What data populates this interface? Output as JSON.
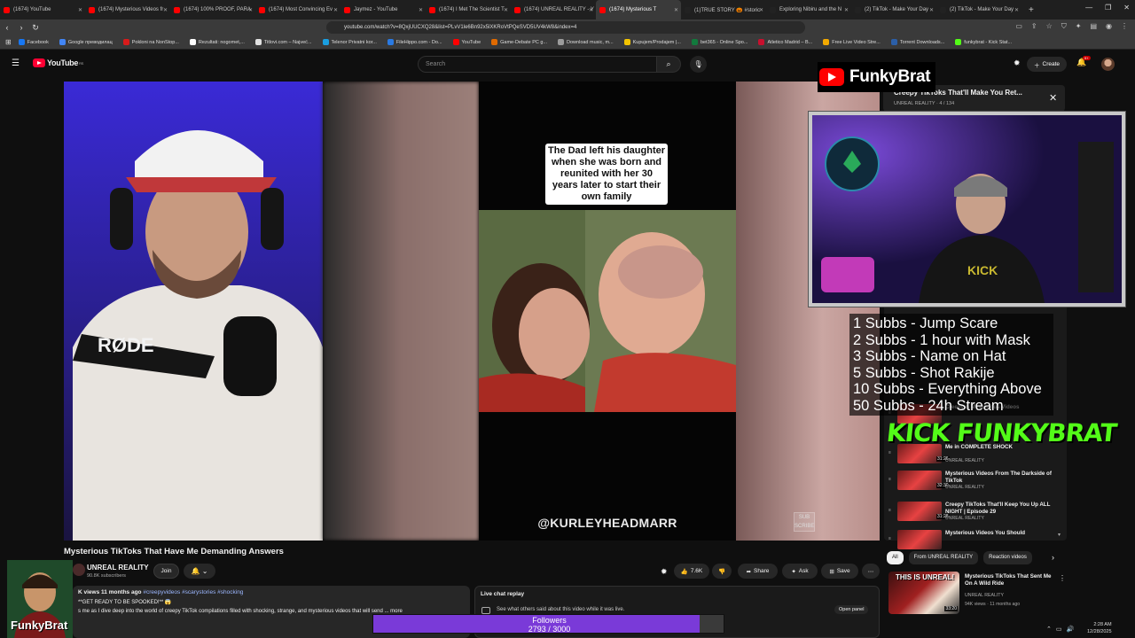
{
  "browser": {
    "tabs": [
      {
        "label": "(1674) YouTube",
        "color": "#ff0000"
      },
      {
        "label": "(1674) Mysterious Videos fr",
        "color": "#ff0000"
      },
      {
        "label": "(1674) 100% PROOF, PARA",
        "color": "#ff0000"
      },
      {
        "label": "(1674) Most Convincing Ev",
        "color": "#ff0000"
      },
      {
        "label": "Jaymez - YouTube",
        "color": "#ff0000"
      },
      {
        "label": "(1674) I Met The Scientist T",
        "color": "#ff0000"
      },
      {
        "label": "(1674) UNREAL REALITY - Y",
        "color": "#ff0000"
      },
      {
        "label": "(1674) Mysterious T",
        "color": "#ff0000",
        "active": true
      },
      {
        "label": "(1)TRUE STORY 🎃 #storic",
        "color": "#222222"
      },
      {
        "label": "Exploring Nibiru and the N",
        "color": "#222222"
      },
      {
        "label": "(2) TikTok - Make Your Day",
        "color": "#222222"
      },
      {
        "label": "(2) TikTok - Make Your Day",
        "color": "#222222"
      }
    ],
    "url": "youtube.com/watch?v=8QxjUUCXQ28&list=PLvV1le6Bn92x5lXKRoVtPQeSVD5UV4kW8&index=4",
    "bookmarks": [
      {
        "label": "Facebook",
        "color": "#1877f2"
      },
      {
        "label": "Google преводилац",
        "color": "#4285f4"
      },
      {
        "label": "Pokloni na NonStop...",
        "color": "#d81b1b"
      },
      {
        "label": "Rezultati: nogomet,...",
        "color": "#ffffff"
      },
      {
        "label": "Titlovi.com – Najveć...",
        "color": "#e0e0e0"
      },
      {
        "label": "Telenor Privatni kor...",
        "color": "#1a9ee0"
      },
      {
        "label": "FileHippo.com - Do...",
        "color": "#2a7ae2"
      },
      {
        "label": "YouTube",
        "color": "#ff0000"
      },
      {
        "label": "Game-Debate PC g...",
        "color": "#e06a00"
      },
      {
        "label": "Download music, m...",
        "color": "#9c9c9c"
      },
      {
        "label": "Kupujem/Prodajem |...",
        "color": "#f4c400"
      },
      {
        "label": "bet365 - Online Spo...",
        "color": "#127a3d"
      },
      {
        "label": "Atletico Madrid – B...",
        "color": "#c8102e"
      },
      {
        "label": "Free Live Video Stre...",
        "color": "#f2a900"
      },
      {
        "label": "Torrent Downloads...",
        "color": "#2b5fa8"
      },
      {
        "label": "funkybrat - Kick Stat...",
        "color": "#53fc18"
      }
    ]
  },
  "youtube": {
    "logo_text": "YouTube",
    "logo_region": "RS",
    "search_placeholder": "Search",
    "create_label": "Create",
    "notif_count": "9+",
    "video_title": "Mysterious TikToks That Have Me Demanding Answers",
    "channel_name": "UNREAL REALITY",
    "channel_subs": "90.8K subscribers",
    "join_label": "Join",
    "like_count": "7.6K",
    "share_label": "Share",
    "ask_label": "Ask",
    "save_label": "Save",
    "desc_meta": "K views  11 months ago",
    "desc_tags": "#creepyvideos #scarystories #shocking",
    "desc_line1": "**GET READY TO BE SPOOKED!** 😱",
    "desc_line2": "s me as I dive deep into the world of creepy TikTok compilations filled with shocking, strange, and mysterious videos that will send ... more",
    "chat_title": "Live chat replay",
    "chat_line": "See what others said about this video while it was live.",
    "open_panel": "Open panel"
  },
  "tiktok": {
    "caption": "The Dad left his daughter when she was born and reunited with her 30 years later to start their own family",
    "watermark": "@KURLEYHEADMARR"
  },
  "miniplayer": {
    "title": "Creepy TikToks That'll Make You Ret...",
    "sub": "UNREAL REALITY · 4 / 134"
  },
  "queue": [
    {
      "title": "Creepy & Mysterious Videos",
      "channel": "",
      "dur": "",
      "idx": ""
    },
    {
      "title": "Me in COMPLETE SHOCK",
      "channel": "UNREAL REALITY",
      "dur": "31:26",
      "idx": ""
    },
    {
      "title": "Mysterious Videos From The Darkside of TikTok",
      "channel": "UNREAL REALITY",
      "dur": "32:30",
      "idx": ""
    },
    {
      "title": "Creepy TikToks That'll Keep You Up ALL NIGHT | Episode 29",
      "channel": "UNREAL REALITY",
      "dur": "31:28",
      "idx": ""
    },
    {
      "title": "Mysterious Videos You Should",
      "channel": "",
      "dur": "",
      "idx": ""
    }
  ],
  "chips": [
    "All",
    "From UNREAL REALITY",
    "Reaction videos"
  ],
  "recommendation": {
    "thumb_label": "THIS IS UNREAL!",
    "title": "Mysterious TikToks That Sent Me On A Wild Ride",
    "channel": "UNREAL REALITY",
    "meta": "94K views · 11 months ago",
    "dur": "33:20"
  },
  "stream": {
    "brand": "FunkyBrat",
    "goals": [
      "1 Subbs - Jump Scare",
      "2 Subbs - 1 hour with Mask",
      "3 Subbs - Name on Hat",
      "5 Subbs - Shot Rakije",
      "10 Subbs - Everything Above",
      "50 Subbs - 24h Stream"
    ],
    "kick_logo": "KICK FUNKYBRAT",
    "avatar_name": "FunkyBrat",
    "followers_label": "Followers",
    "followers_text": "2793 / 3000",
    "followers_current": 2793,
    "followers_goal": 3000
  },
  "system": {
    "time": "2:28 AM",
    "date": "12/28/2025"
  }
}
